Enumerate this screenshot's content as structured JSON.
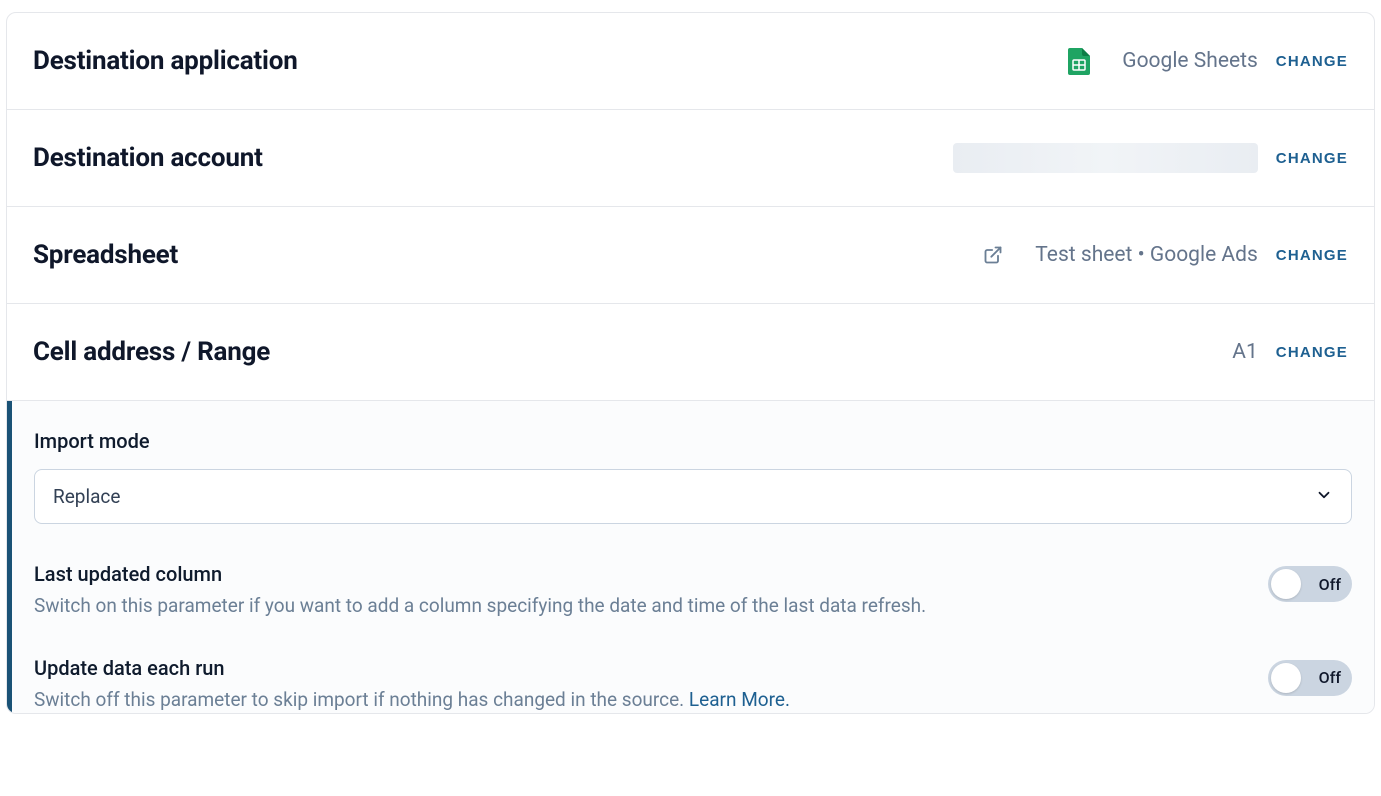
{
  "rows": {
    "destination_app": {
      "title": "Destination application",
      "value": "Google Sheets",
      "change": "CHANGE"
    },
    "destination_account": {
      "title": "Destination account",
      "change": "CHANGE"
    },
    "spreadsheet": {
      "title": "Spreadsheet",
      "value": "Test sheet • Google Ads",
      "change": "CHANGE"
    },
    "cell_range": {
      "title": "Cell address / Range",
      "value": "A1",
      "change": "CHANGE"
    }
  },
  "import_mode": {
    "label": "Import mode",
    "selected": "Replace"
  },
  "last_updated": {
    "title": "Last updated column",
    "desc": "Switch on this parameter if you want to add a column specifying the date and time of the last data refresh.",
    "state": "Off"
  },
  "update_each_run": {
    "title": "Update data each run",
    "desc": "Switch off this parameter to skip import if nothing has changed in the source. ",
    "learn_more": "Learn More.",
    "state": "Off"
  }
}
